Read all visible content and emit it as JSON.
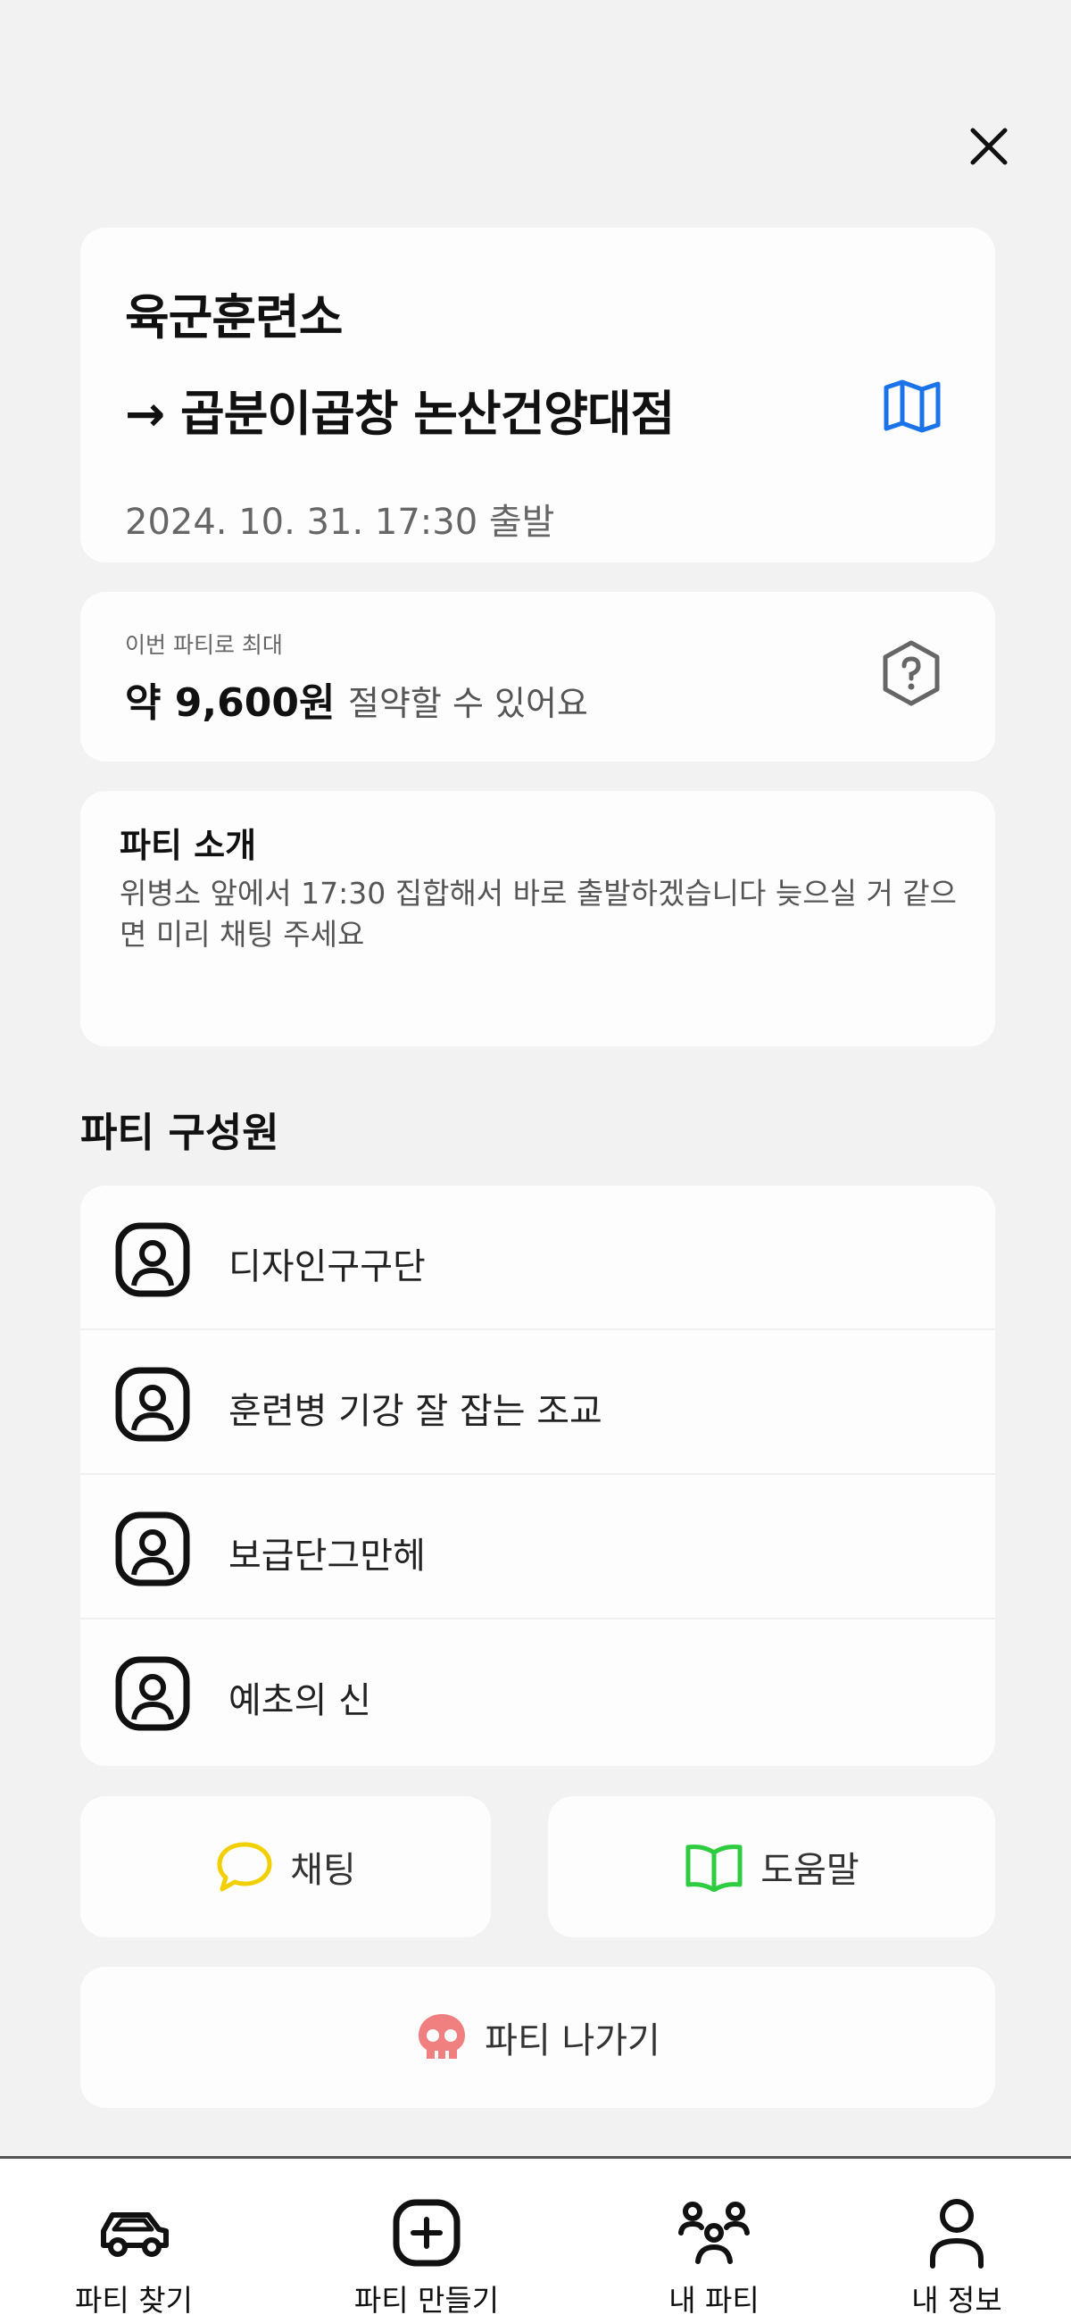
{
  "route": {
    "origin": "육군훈련소",
    "destination": "→ 곱분이곱창 논산건양대점",
    "departure": "2024. 10. 31. 17:30 출발"
  },
  "savings": {
    "caption": "이번 파티로 최대",
    "amount": "약 9,600원",
    "suffix": "절약할 수 있어요"
  },
  "intro": {
    "title": "파티 소개",
    "body": "위병소 앞에서 17:30 집합해서 바로 출발하겠습니다 늦으실 거 같으면 미리 채팅 주세요"
  },
  "members": {
    "heading": "파티 구성원",
    "list": [
      {
        "name": "디자인구구단"
      },
      {
        "name": "훈련병 기강 잘 잡는 조교"
      },
      {
        "name": "보급단그만헤"
      },
      {
        "name": "예초의 신"
      }
    ]
  },
  "actions": {
    "chat_label": "채팅",
    "help_label": "도움말",
    "leave_label": "파티 나가기"
  },
  "nav": {
    "find": "파티 찾기",
    "create": "파티 만들기",
    "my_party": "내 파티",
    "profile": "내 정보"
  },
  "colors": {
    "map_icon": "#1a73e8",
    "chat_icon": "#f2d000",
    "help_icon": "#2ecc40",
    "leave_icon": "#f08080"
  }
}
